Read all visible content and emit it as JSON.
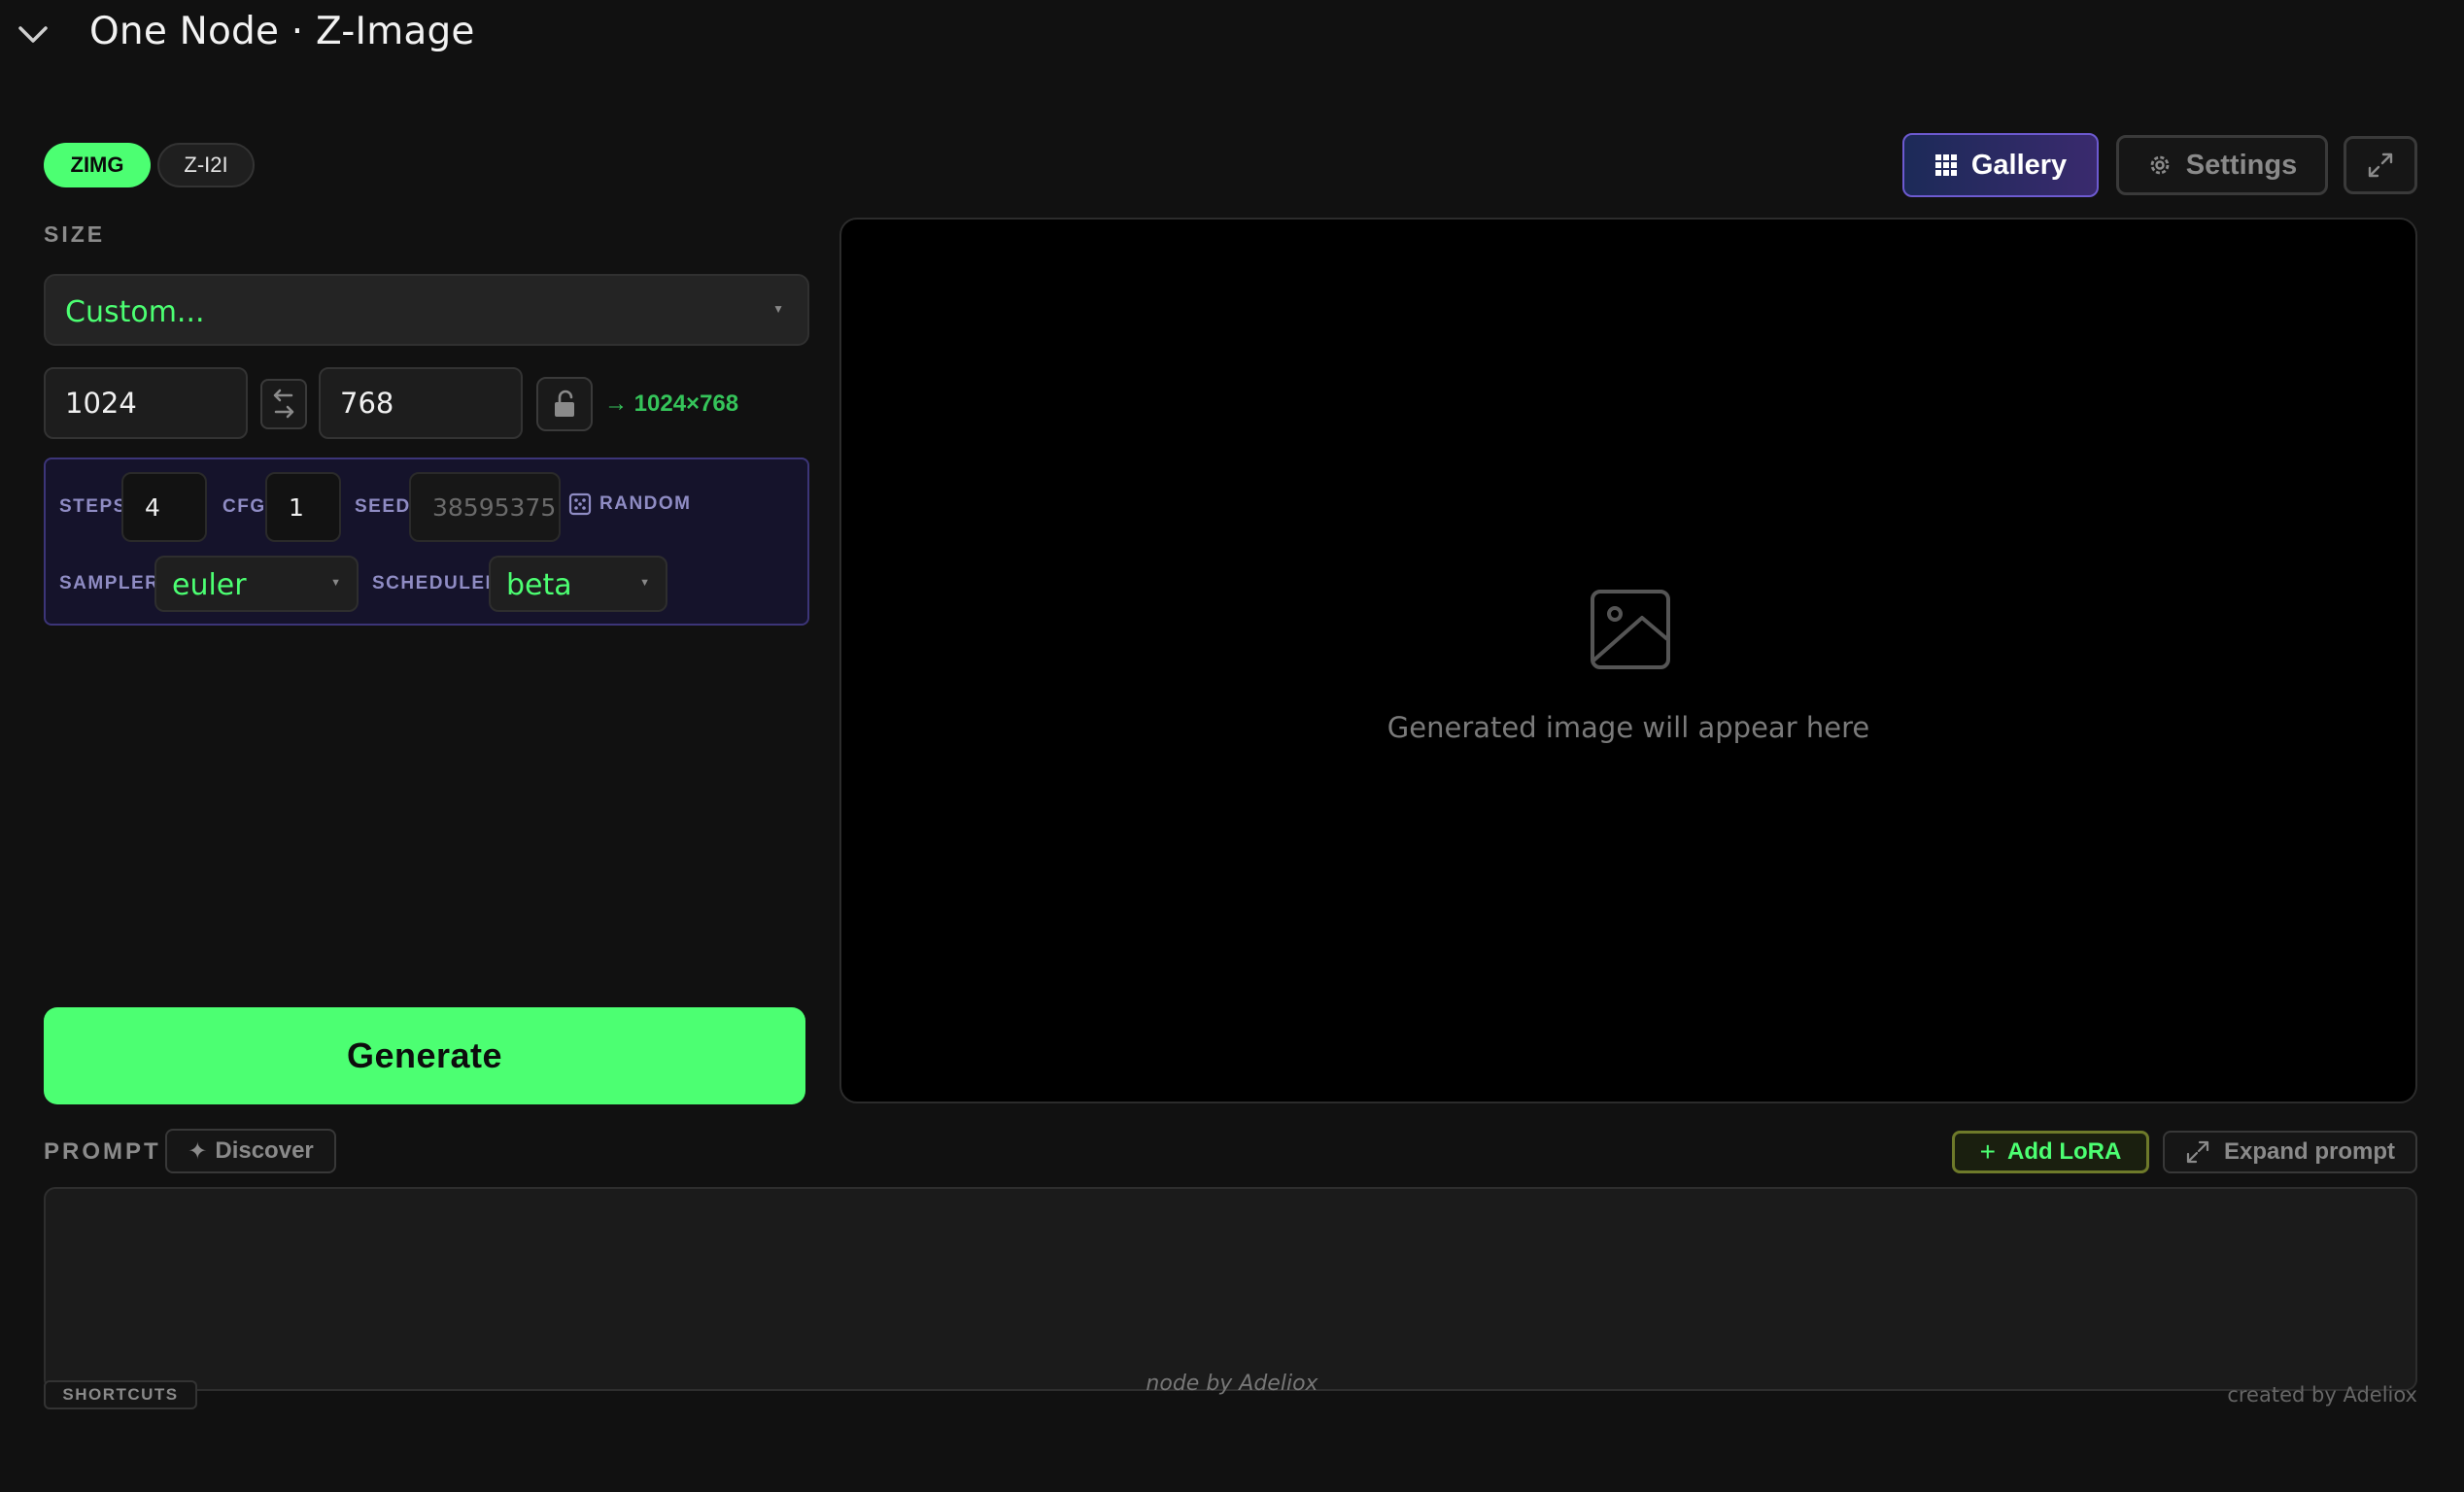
{
  "header": {
    "title": "One Node · Z-Image"
  },
  "model_tabs": [
    {
      "label": "ZIMG",
      "active": true
    },
    {
      "label": "Z-I2I",
      "active": false
    }
  ],
  "size": {
    "label": "SIZE",
    "preset": "Custom...",
    "width": "1024",
    "height": "768",
    "result": "→ 1024×768"
  },
  "params": {
    "steps_label": "STEPS",
    "steps": "4",
    "cfg_label": "CFG",
    "cfg": "1",
    "seed_label": "SEED",
    "seed": "38595375",
    "random_label": "RANDOM",
    "sampler_label": "SAMPLER",
    "sampler": "euler",
    "scheduler_label": "SCHEDULER",
    "scheduler": "beta"
  },
  "generate_label": "Generate",
  "toolbar": {
    "gallery_label": "Gallery",
    "settings_label": "Settings"
  },
  "preview": {
    "placeholder": "Generated image will appear here"
  },
  "prompt": {
    "label": "PROMPT",
    "discover_label": "Discover",
    "add_lora_label": "Add LoRA",
    "expand_label": "Expand prompt",
    "value": ""
  },
  "footer": {
    "shortcuts_label": "SHORTCUTS",
    "node_by": "node by Adeliox",
    "created_by": "created by Adeliox"
  },
  "colors": {
    "accent": "#4cff72",
    "background": "#111111",
    "params_panel": "#15132b"
  }
}
